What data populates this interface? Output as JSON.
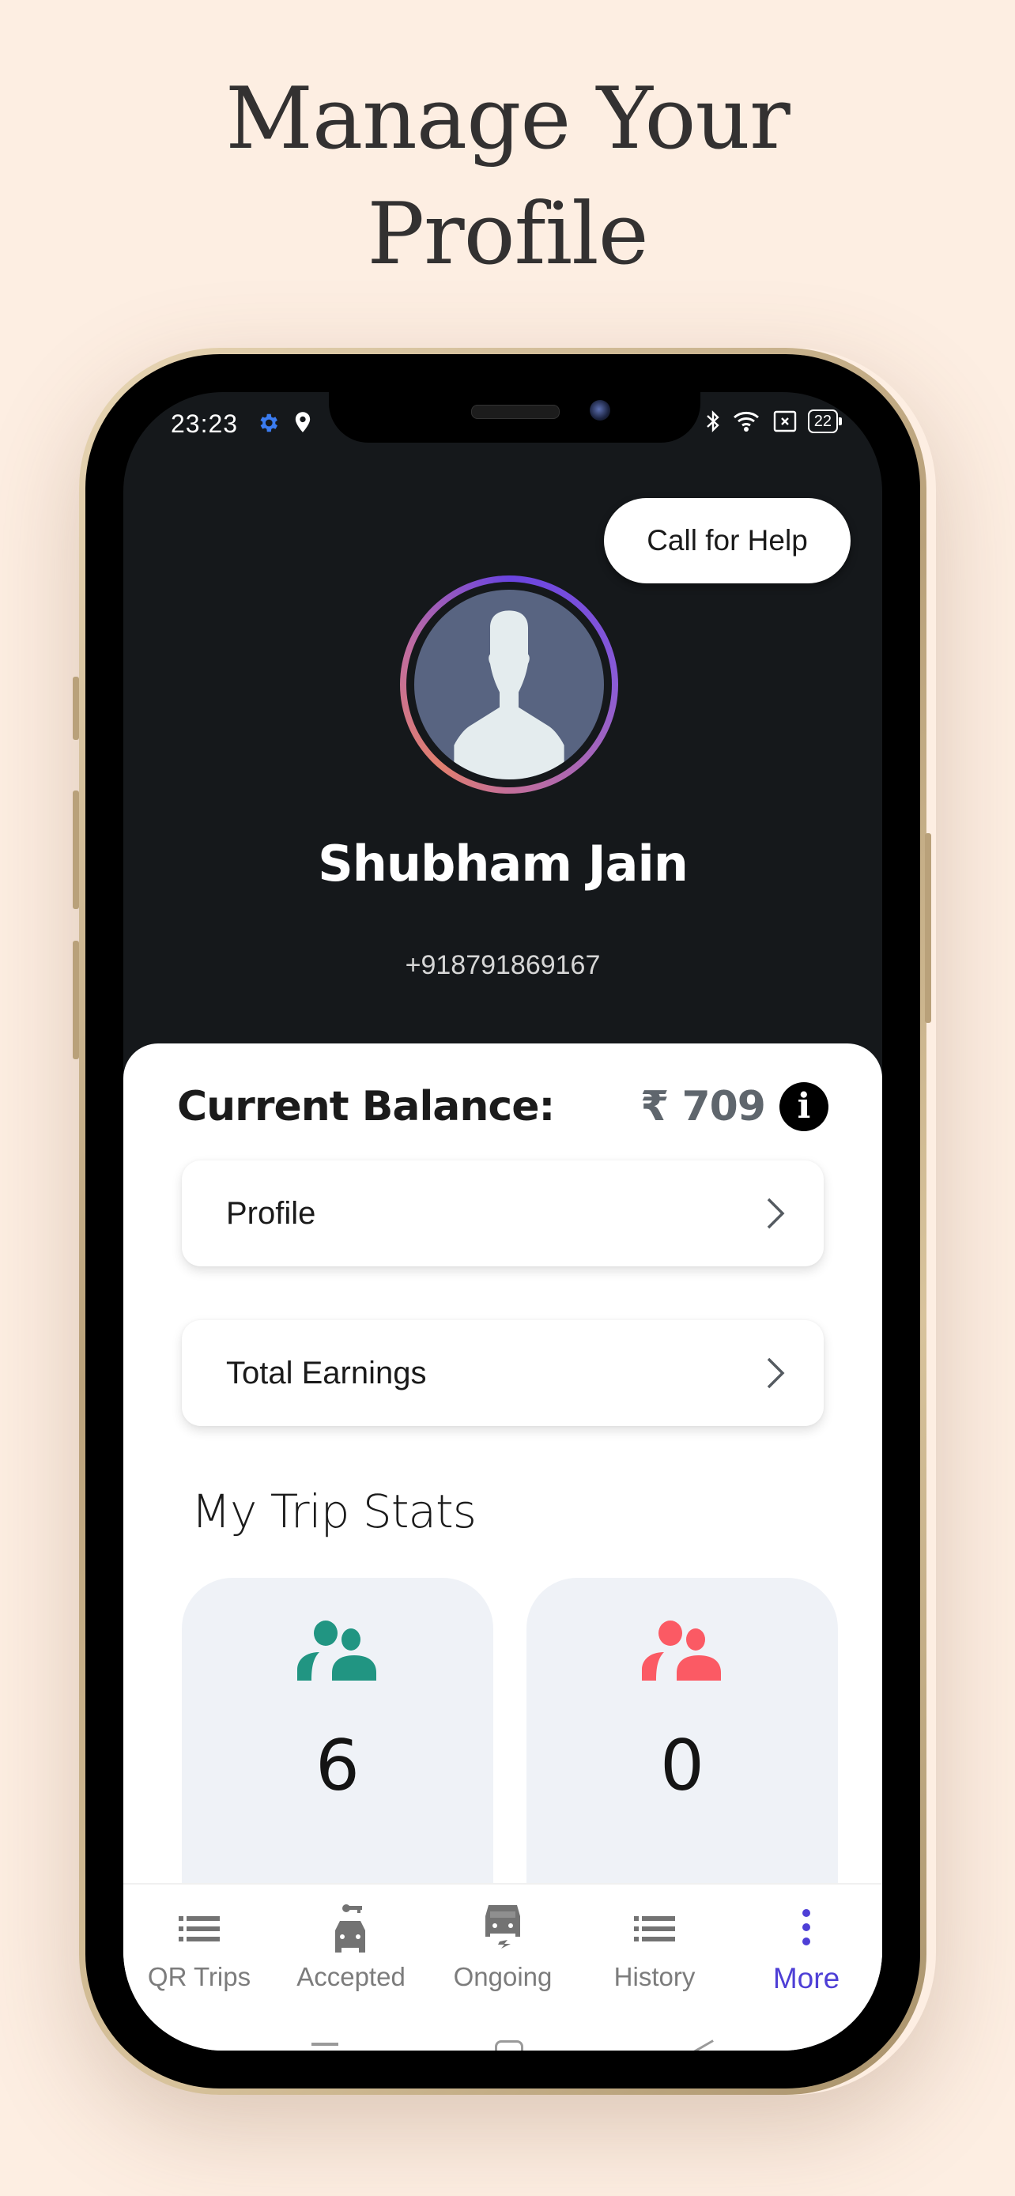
{
  "headline": {
    "line1": "Manage Your",
    "line2": "Profile"
  },
  "status_bar": {
    "time": "23:23",
    "left_icons": [
      "gear-icon",
      "location-pin-icon"
    ],
    "right_icons": [
      "bluetooth-icon",
      "wifi-icon",
      "no-sim-icon",
      "battery-icon"
    ],
    "battery_level": "22",
    "colors": {
      "gear": "#3b7cf0"
    }
  },
  "header": {
    "help_button": "Call for Help",
    "user_name": "Shubham Jain",
    "user_phone": "+918791869167"
  },
  "balance": {
    "label": "Current Balance:",
    "value": "₹ 709"
  },
  "menu": [
    {
      "label": "Profile"
    },
    {
      "label": "Total Earnings"
    }
  ],
  "trip_stats": {
    "title": "My Trip Stats",
    "cards": [
      {
        "value": "6",
        "icon": "people-icon",
        "color": "#219582"
      },
      {
        "value": "0",
        "icon": "people-icon",
        "color": "#fb5a64"
      }
    ]
  },
  "bottom_nav": {
    "items": [
      {
        "label": "QR Trips",
        "icon": "list-icon",
        "active": false
      },
      {
        "label": "Accepted",
        "icon": "car-key-icon",
        "active": false
      },
      {
        "label": "Ongoing",
        "icon": "car-ongoing-icon",
        "active": false
      },
      {
        "label": "History",
        "icon": "list-icon",
        "active": false
      },
      {
        "label": "More",
        "icon": "more-vertical-icon",
        "active": true
      }
    ],
    "active_color": "#4e3fd6",
    "inactive_color": "#7c7c7c"
  }
}
